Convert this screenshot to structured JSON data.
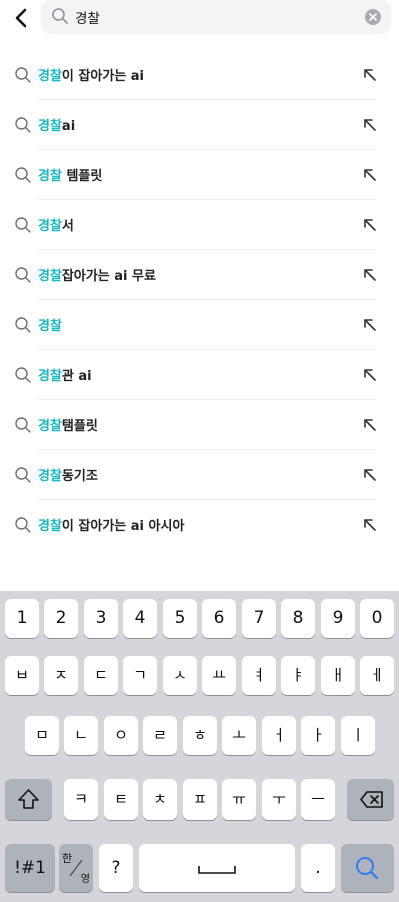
{
  "search": {
    "query": "경찰",
    "placeholder": ""
  },
  "suggestions": [
    {
      "highlight": "경찰",
      "rest": "이 잡아가는 ai"
    },
    {
      "highlight": "경찰",
      "rest": "ai"
    },
    {
      "highlight": "경찰",
      "rest": " 템플릿"
    },
    {
      "highlight": "경찰",
      "rest": "서"
    },
    {
      "highlight": "경찰",
      "rest": "잡아가는 ai 무료"
    },
    {
      "highlight": "경찰",
      "rest": ""
    },
    {
      "highlight": "경찰",
      "rest": "관 ai"
    },
    {
      "highlight": "경찰",
      "rest": "탬플릿"
    },
    {
      "highlight": "경찰",
      "rest": "동기조"
    },
    {
      "highlight": "경찰",
      "rest": "이 잡아가는 ai 아시아"
    }
  ],
  "keyboard": {
    "numbers": [
      "1",
      "2",
      "3",
      "4",
      "5",
      "6",
      "7",
      "8",
      "9",
      "0"
    ],
    "row1": [
      "ㅂ",
      "ㅈ",
      "ㄷ",
      "ㄱ",
      "ㅅ",
      "ㅛ",
      "ㅕ",
      "ㅑ",
      "ㅐ",
      "ㅔ"
    ],
    "row2": [
      "ㅁ",
      "ㄴ",
      "ㅇ",
      "ㄹ",
      "ㅎ",
      "ㅗ",
      "ㅓ",
      "ㅏ",
      "ㅣ"
    ],
    "row3": [
      "ㅋ",
      "ㅌ",
      "ㅊ",
      "ㅍ",
      "ㅠ",
      "ㅜ",
      "ㅡ"
    ],
    "symbols_label": "!#1",
    "lang_top": "한",
    "lang_bottom": "영",
    "question_label": "?",
    "period_label": "."
  },
  "colors": {
    "highlight": "#17b6c4",
    "keyboard_bg": "#d4d6dc"
  }
}
